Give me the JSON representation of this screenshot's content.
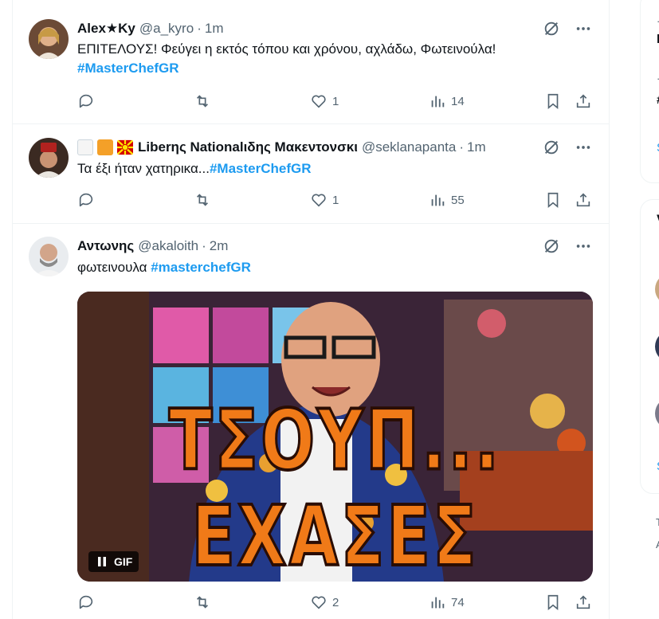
{
  "tweets": [
    {
      "display_name": "Alex★Ky",
      "handle": "@a_kyro",
      "separator": "·",
      "time": "1m",
      "text": "ΕΠΙΤΕΛΟΥΣ! Φεύγει η εκτός τόπου και χρόνου, αχλάδω, Φωτεινούλα!",
      "hashtag": "#MasterChefGR",
      "likes": "1",
      "views": "14"
    },
    {
      "display_name": "Liberης Nationalιδης Μακεντονσκι",
      "handle": "@seklanapanta",
      "separator": "·",
      "time": "1m",
      "text": "Τα έξι ήταν χατηρικα...",
      "hashtag": "#MasterChefGR",
      "likes": "1",
      "views": "55"
    },
    {
      "display_name": "Αντωνης",
      "handle": "@akaloith",
      "separator": "·",
      "time": "2m",
      "text": "φωτεινουλα",
      "hashtag": "#masterchefGR",
      "gif_caption": "ΤΣΟΥΠ... ΕΧΑΣΕΣ",
      "gif_badge": "GIF",
      "likes": "2",
      "views": "74"
    }
  ],
  "colors": {
    "accent": "#1d9bf0",
    "text": "#0f1419",
    "muted": "#536471",
    "border": "#eff3f4",
    "gif_caption": "#f07a18"
  },
  "icons": [
    "grok-icon",
    "more-icon",
    "reply-icon",
    "repost-icon",
    "like-icon",
    "views-icon",
    "bookmark-icon",
    "share-icon",
    "pause-icon"
  ],
  "right_column": {
    "item1": "l",
    "item2": "#",
    "link1": "S",
    "heading": "V",
    "link2": "S",
    "footer1": "T",
    "footer2": "A"
  }
}
